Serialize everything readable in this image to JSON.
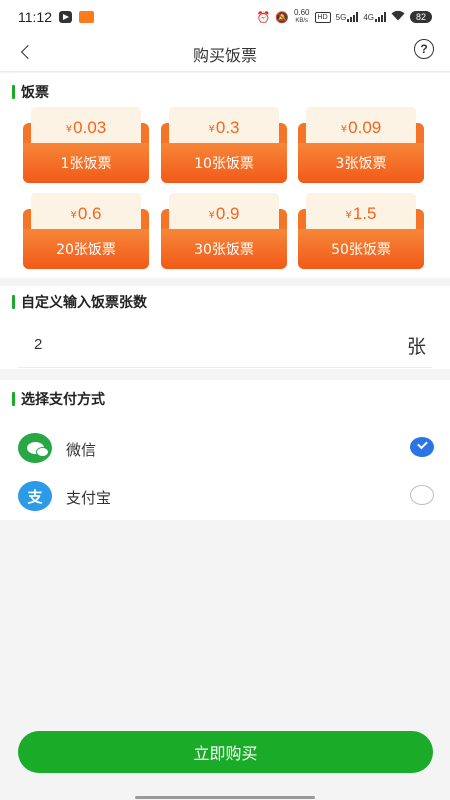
{
  "status_bar": {
    "time": "11:12",
    "network_speed": "0.60",
    "network_speed_unit": "KB/s",
    "hd_badge": "HD",
    "net_5g": "5G",
    "net_4g": "4G",
    "battery": "82"
  },
  "nav": {
    "title": "购买饭票",
    "help_symbol": "?"
  },
  "tickets_section": {
    "title": "饭票",
    "currency_symbol": "¥",
    "tickets": [
      {
        "price": "0.03",
        "label": "1张饭票"
      },
      {
        "price": "0.3",
        "label": "10张饭票"
      },
      {
        "price": "0.09",
        "label": "3张饭票"
      },
      {
        "price": "0.6",
        "label": "20张饭票"
      },
      {
        "price": "0.9",
        "label": "30张饭票"
      },
      {
        "price": "1.5",
        "label": "50张饭票"
      }
    ]
  },
  "custom_section": {
    "title": "自定义输入饭票张数",
    "value": "2",
    "unit": "张"
  },
  "payment_section": {
    "title": "选择支付方式",
    "methods": [
      {
        "label": "微信",
        "icon": "wechat-icon",
        "color": "#27a844",
        "selected": true
      },
      {
        "label": "支付宝",
        "icon": "alipay-icon",
        "color": "#2d9ae8",
        "selected": false
      }
    ],
    "alipay_glyph": "支"
  },
  "buy_button": {
    "label": "立即购买",
    "color": "#1aab28"
  },
  "colors": {
    "accent_green": "#1aab28",
    "ticket_orange": "#f47528",
    "ticket_paper": "#fdf3e4",
    "radio_selected": "#2a74e5"
  }
}
